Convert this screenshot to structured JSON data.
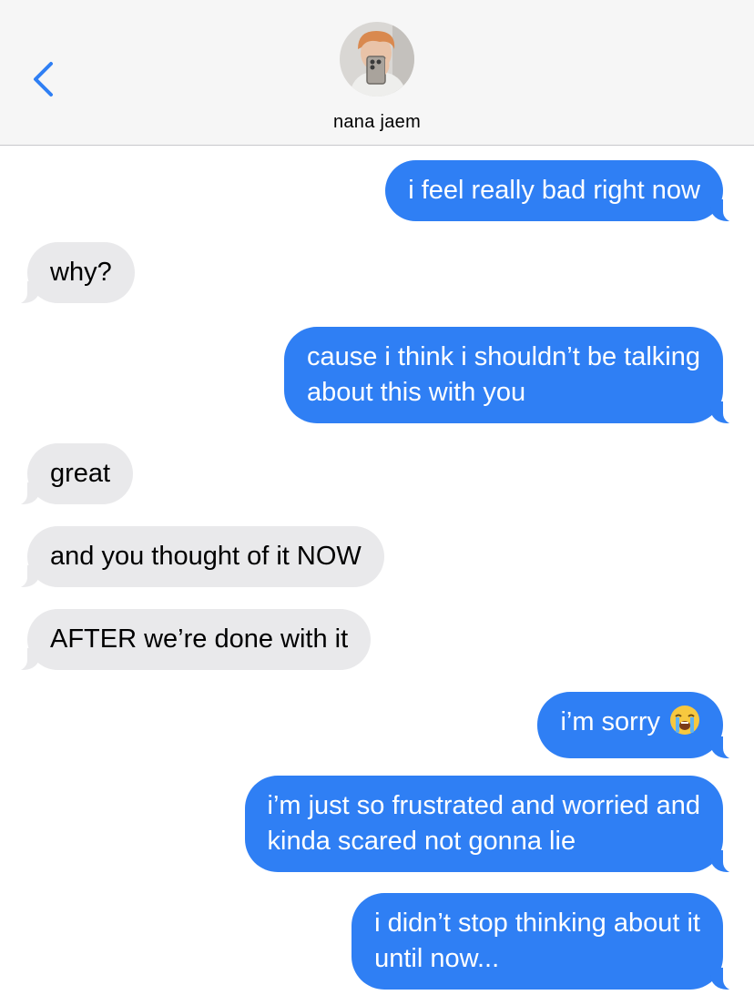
{
  "header": {
    "contact_name": "nana jaem"
  },
  "colors": {
    "sent_bubble": "#2f7ff4",
    "received_bubble": "#e9e9eb",
    "accent": "#2f7ff4"
  },
  "icons": {
    "back": "chevron-left-icon",
    "avatar": "contact-avatar-photo",
    "emoji": "loudly-crying-face-emoji"
  },
  "messages": [
    {
      "from": "me",
      "text": "i feel really bad right now"
    },
    {
      "from": "them",
      "text": "why?"
    },
    {
      "from": "me",
      "text": "cause i think i shouldn’t be talking\nabout this with you"
    },
    {
      "from": "them",
      "text": "great"
    },
    {
      "from": "them",
      "text": "and you thought of it NOW"
    },
    {
      "from": "them",
      "text": "AFTER we’re done with it"
    },
    {
      "from": "me",
      "text": "i’m sorry"
    },
    {
      "from": "me",
      "text": "i’m just so frustrated and worried and\nkinda scared not gonna lie"
    },
    {
      "from": "me",
      "text": "i didn’t stop thinking about it\nuntil now..."
    }
  ]
}
